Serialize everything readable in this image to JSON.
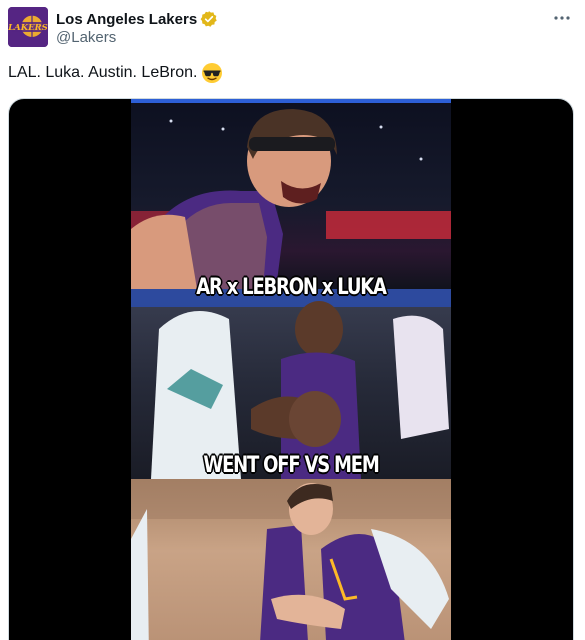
{
  "author": {
    "display_name": "Los Angeles Lakers",
    "handle": "@Lakers",
    "avatar_text": "LAKERS",
    "verified": true
  },
  "tweet": {
    "text": "LAL. Luka. Austin. LeBron.",
    "emoji": "sunglasses-face"
  },
  "media": {
    "captions": [
      "AR x LEBRON x LUKA",
      "WENT OFF VS MEM"
    ]
  },
  "colors": {
    "brand_purple": "#552583",
    "brand_gold": "#fdb927",
    "verified_gold": "#e2b719"
  }
}
